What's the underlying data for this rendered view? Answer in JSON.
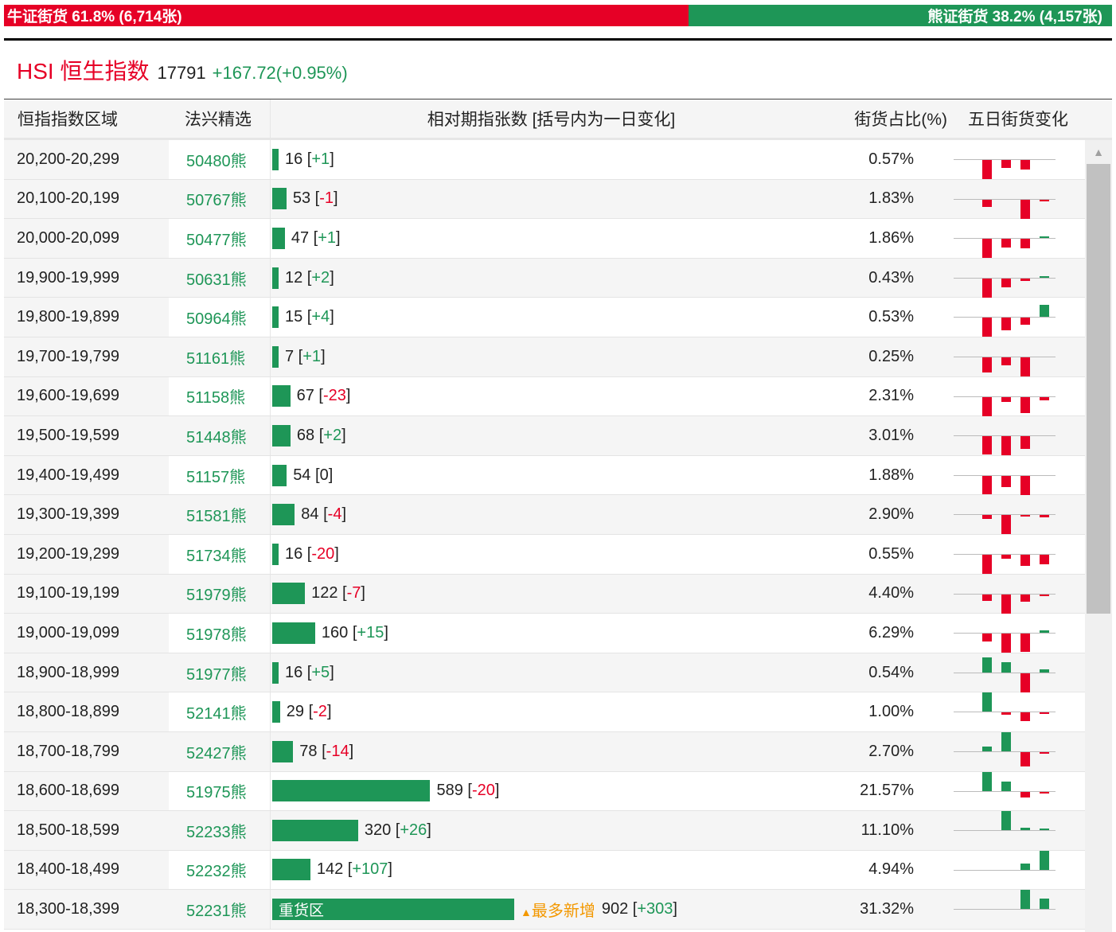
{
  "topbar": {
    "bull_label": "牛证街货 61.8% (6,714张)",
    "bull_pct": 61.8,
    "bear_label": "熊证街货 38.2% (4,157张)",
    "bear_pct": 38.2
  },
  "index": {
    "name": "HSI 恒生指数",
    "value": "17791",
    "change": "+167.72(+0.95%)"
  },
  "headers": [
    "恒指指数区域",
    "法兴精选",
    "相对期指张数 [括号内为一日变化]",
    "街货占比(%)",
    "五日街货变化"
  ],
  "colors": {
    "red": "#e60026",
    "green": "#1e9657",
    "orange": "#f39800"
  },
  "rows": [
    {
      "range": "20,200-20,299",
      "pick": "50480熊",
      "count": 16,
      "delta": "+1",
      "pct": "0.57%",
      "five": [
        -1,
        -0.4,
        -0.5,
        0
      ]
    },
    {
      "range": "20,100-20,199",
      "pick": "50767熊",
      "count": 53,
      "delta": "-1",
      "pct": "1.83%",
      "five": [
        -0.4,
        0,
        -1,
        -0.1
      ]
    },
    {
      "range": "20,000-20,099",
      "pick": "50477熊",
      "count": 47,
      "delta": "+1",
      "pct": "1.86%",
      "five": [
        -1,
        -0.45,
        -0.5,
        0.08
      ]
    },
    {
      "range": "19,900-19,999",
      "pick": "50631熊",
      "count": 12,
      "delta": "+2",
      "pct": "0.43%",
      "five": [
        -1,
        -0.45,
        -0.15,
        0.08
      ]
    },
    {
      "range": "19,800-19,899",
      "pick": "50964熊",
      "count": 15,
      "delta": "+4",
      "pct": "0.53%",
      "five": [
        -1,
        -0.65,
        -0.35,
        0.65
      ]
    },
    {
      "range": "19,700-19,799",
      "pick": "51161熊",
      "count": 7,
      "delta": "+1",
      "pct": "0.25%",
      "five": [
        -0.8,
        -0.4,
        -1,
        0
      ]
    },
    {
      "range": "19,600-19,699",
      "pick": "51158熊",
      "count": 67,
      "delta": "-23",
      "pct": "2.31%",
      "five": [
        -1,
        -0.25,
        -0.85,
        -0.2
      ]
    },
    {
      "range": "19,500-19,599",
      "pick": "51448熊",
      "count": 68,
      "delta": "+2",
      "pct": "3.01%",
      "five": [
        -0.95,
        -1,
        -0.65,
        0
      ]
    },
    {
      "range": "19,400-19,499",
      "pick": "51157熊",
      "count": 54,
      "delta": "0",
      "pct": "1.88%",
      "five": [
        -0.95,
        -0.6,
        -1,
        0
      ]
    },
    {
      "range": "19,300-19,399",
      "pick": "51581熊",
      "count": 84,
      "delta": "-4",
      "pct": "2.90%",
      "five": [
        -0.2,
        -1,
        -0.05,
        -0.1
      ]
    },
    {
      "range": "19,200-19,299",
      "pick": "51734熊",
      "count": 16,
      "delta": "-20",
      "pct": "0.55%",
      "five": [
        -1,
        -0.2,
        -0.6,
        -0.5
      ]
    },
    {
      "range": "19,100-19,199",
      "pick": "51979熊",
      "count": 122,
      "delta": "-7",
      "pct": "4.40%",
      "five": [
        -0.35,
        -1,
        -0.4,
        -0.05
      ]
    },
    {
      "range": "19,000-19,099",
      "pick": "51978熊",
      "count": 160,
      "delta": "+15",
      "pct": "6.29%",
      "five": [
        -0.4,
        -1,
        -0.95,
        0.12
      ]
    },
    {
      "range": "18,900-18,999",
      "pick": "51977熊",
      "count": 16,
      "delta": "+5",
      "pct": "0.54%",
      "five": [
        0.8,
        0.55,
        -1,
        0.15
      ]
    },
    {
      "range": "18,800-18,899",
      "pick": "52141熊",
      "count": 29,
      "delta": "-2",
      "pct": "1.00%",
      "five": [
        1,
        -0.12,
        -0.45,
        -0.08
      ]
    },
    {
      "range": "18,700-18,799",
      "pick": "52427熊",
      "count": 78,
      "delta": "-14",
      "pct": "2.70%",
      "five": [
        0.25,
        1,
        -0.75,
        -0.08
      ]
    },
    {
      "range": "18,600-18,699",
      "pick": "51975熊",
      "count": 589,
      "delta": "-20",
      "pct": "21.57%",
      "five": [
        1,
        0.5,
        -0.3,
        -0.08
      ]
    },
    {
      "range": "18,500-18,599",
      "pick": "52233熊",
      "count": 320,
      "delta": "+26",
      "pct": "11.10%",
      "five": [
        0,
        1,
        0.12,
        0.08
      ]
    },
    {
      "range": "18,400-18,499",
      "pick": "52232熊",
      "count": 142,
      "delta": "+107",
      "pct": "4.94%",
      "five": [
        0,
        0,
        0.33,
        1
      ]
    },
    {
      "range": "18,300-18,399",
      "pick": "52231熊",
      "count": 902,
      "delta": "+303",
      "pct": "31.32%",
      "five": [
        0,
        0,
        1,
        0.55
      ],
      "bar_label": "重货区",
      "tag": "最多新增"
    }
  ]
}
